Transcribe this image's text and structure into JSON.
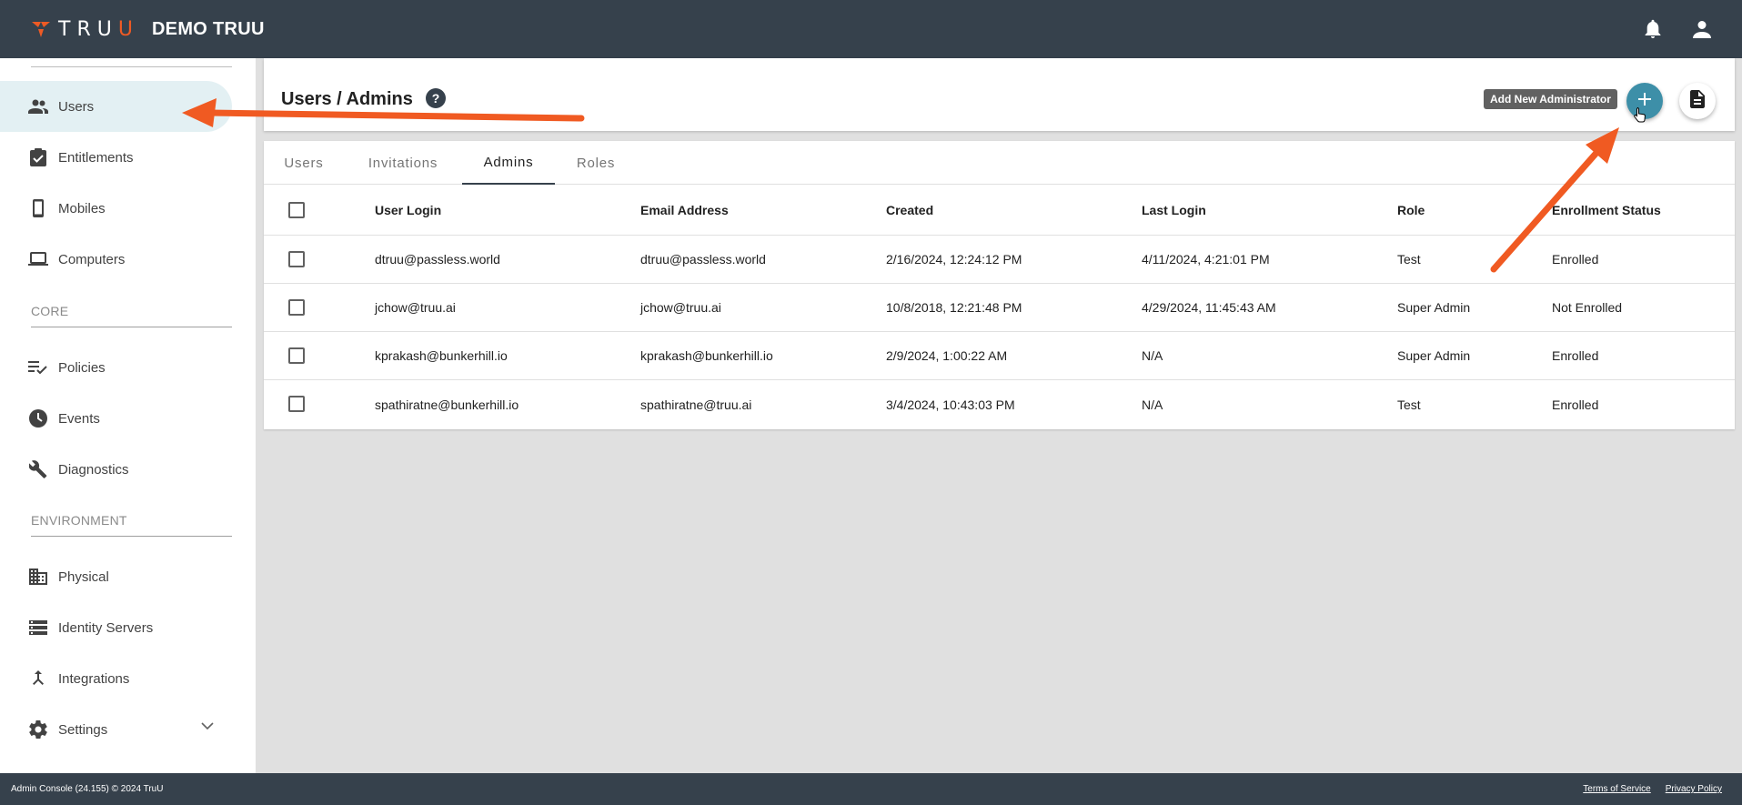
{
  "app": {
    "brand_word_1": "TRU",
    "brand_word_2": "U",
    "org_name": "DEMO TRUU",
    "icons": [
      "notifications-icon",
      "account-icon"
    ]
  },
  "sidebar": {
    "items_top": [
      {
        "label": "Users",
        "icon": "users-icon",
        "active": true
      },
      {
        "label": "Entitlements",
        "icon": "clipboard-check-icon"
      },
      {
        "label": "Mobiles",
        "icon": "phone-icon"
      },
      {
        "label": "Computers",
        "icon": "laptop-icon"
      }
    ],
    "section_core": "CORE",
    "items_core": [
      {
        "label": "Policies",
        "icon": "policy-list-icon"
      },
      {
        "label": "Events",
        "icon": "clock-icon"
      },
      {
        "label": "Diagnostics",
        "icon": "wrench-icon"
      }
    ],
    "section_env": "ENVIRONMENT",
    "items_env": [
      {
        "label": "Physical",
        "icon": "building-icon"
      },
      {
        "label": "Identity Servers",
        "icon": "server-icon"
      },
      {
        "label": "Integrations",
        "icon": "merge-icon"
      },
      {
        "label": "Settings",
        "icon": "gear-icon"
      }
    ]
  },
  "header": {
    "title": "Users / Admins",
    "help": "?",
    "tooltip": "Add New Administrator"
  },
  "tabs": [
    "Users",
    "Invitations",
    "Admins",
    "Roles"
  ],
  "active_tab": "Admins",
  "table": {
    "columns": [
      "User Login",
      "Email Address",
      "Created",
      "Last Login",
      "Role",
      "Enrollment Status"
    ],
    "rows": [
      [
        "dtruu@passless.world",
        "dtruu@passless.world",
        "2/16/2024, 12:24:12 PM",
        "4/11/2024, 4:21:01 PM",
        "Test",
        "Enrolled"
      ],
      [
        "jchow@truu.ai",
        "jchow@truu.ai",
        "10/8/2018, 12:21:48 PM",
        "4/29/2024, 11:45:43 AM",
        "Super Admin",
        "Not Enrolled"
      ],
      [
        "kprakash@bunkerhill.io",
        "kprakash@bunkerhill.io",
        "2/9/2024, 1:00:22 AM",
        "N/A",
        "Super Admin",
        "Enrolled"
      ],
      [
        "spathiratne@bunkerhill.io",
        "spathiratne@truu.ai",
        "3/4/2024, 10:43:03 PM",
        "N/A",
        "Test",
        "Enrolled"
      ]
    ]
  },
  "footer": {
    "copyright": "Admin Console (24.155) © 2024 TruU",
    "terms": "Terms of Service",
    "privacy": "Privacy Policy"
  },
  "colors": {
    "topbar": "#36414c",
    "accent": "#3d8fa8",
    "brand_orange": "#ee5a24",
    "annotation_arrow": "#f05a22"
  }
}
